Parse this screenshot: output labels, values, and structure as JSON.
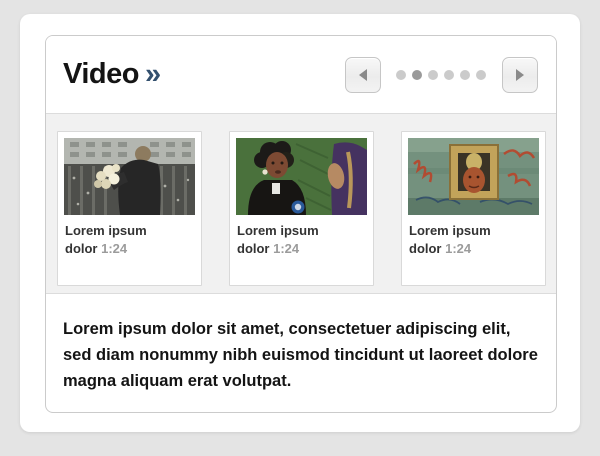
{
  "widget": {
    "title": "Video",
    "title_arrow": "»",
    "carousel": {
      "dots": {
        "count": 6,
        "active_index": 1
      }
    },
    "videos": [
      {
        "title": "Lorem ipsum dolor",
        "duration": "1:24",
        "thumb": "man-carrying-flowers-at-memorial"
      },
      {
        "title": "Lorem ipsum dolor",
        "duration": "1:24",
        "thumb": "woman-interviewed-green-background"
      },
      {
        "title": "Lorem ipsum dolor",
        "duration": "1:24",
        "thumb": "framed-face-on-graffiti-wall"
      }
    ],
    "description": "Lorem ipsum dolor sit amet, consectetuer adipiscing elit, sed diam nonummy nibh euismod tincidunt ut laoreet dolore magna aliquam erat volutpat."
  },
  "colors": {
    "page_background": "#e4e4e4",
    "card_background": "#ffffff",
    "strip_background": "#f1f1f1",
    "border": "#cbcbcb",
    "title_text": "#141414",
    "title_arrow": "#33506e",
    "caption_text": "#333333",
    "duration_text": "#9b9b9b",
    "dot_inactive": "#cbcbcb",
    "dot_active": "#9a9a9a"
  }
}
